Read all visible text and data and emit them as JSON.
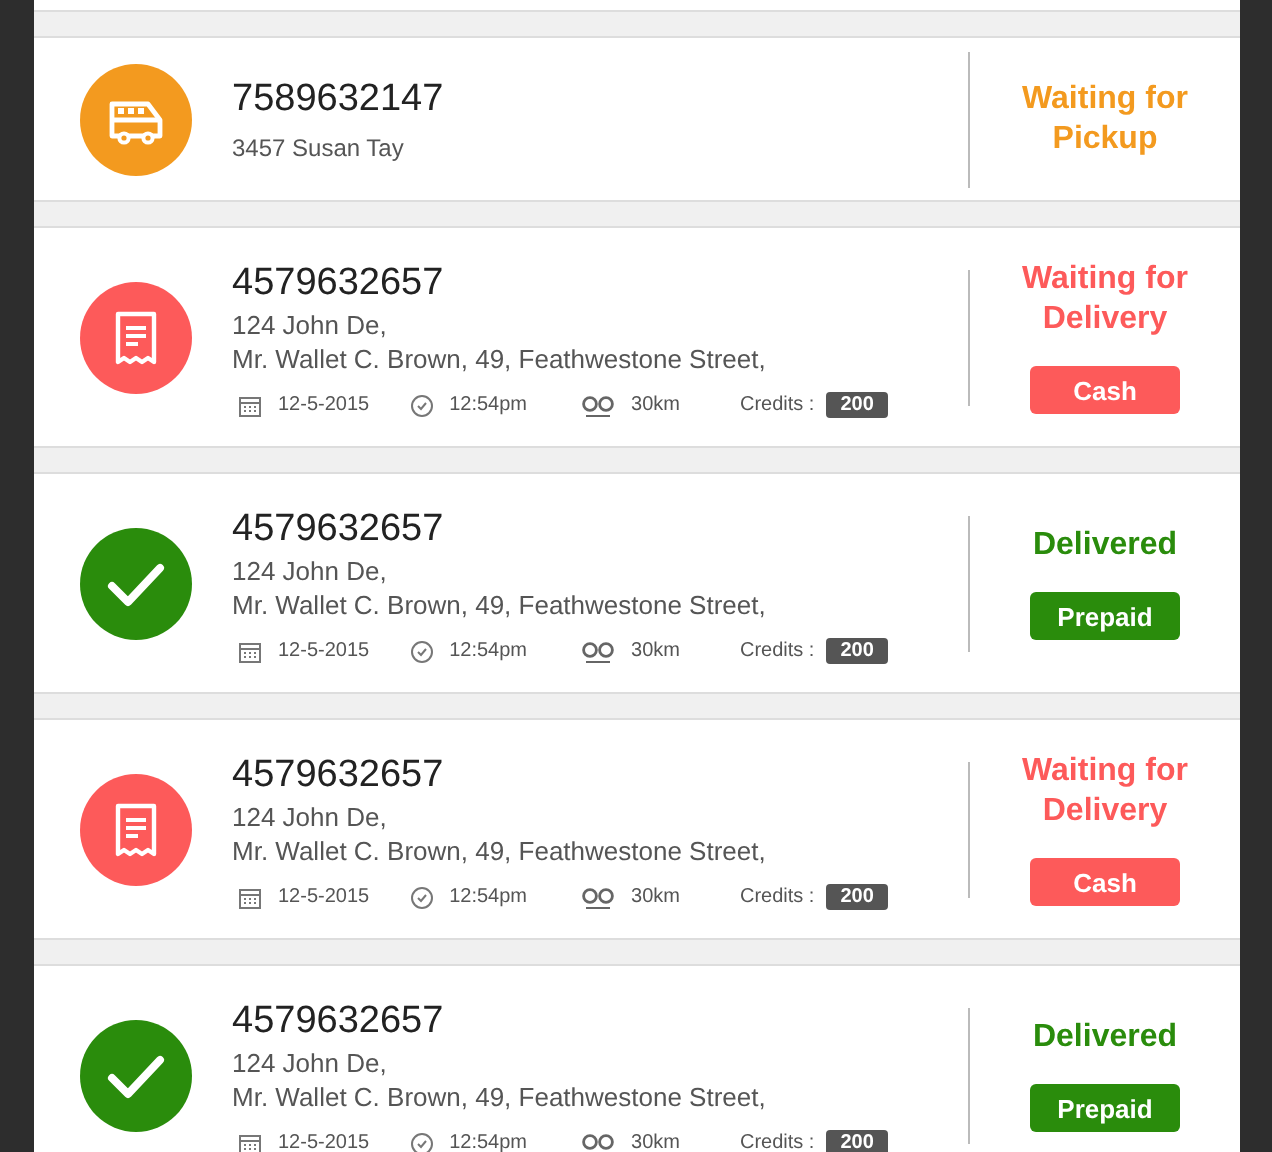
{
  "orders": [
    {
      "kind": "pickup",
      "phone": "7589632147",
      "address_lines": [
        "3457 Susan Tay"
      ],
      "status": "Waiting for Pickup"
    },
    {
      "kind": "delivery",
      "phone": "4579632657",
      "address_lines": [
        "124 John De,",
        "Mr. Wallet C. Brown, 49, Feathwestone Street,"
      ],
      "date": "12-5-2015",
      "time": "12:54pm",
      "distance": "30km",
      "credits_label": "Credits :",
      "credits": "200",
      "status": "Waiting for Delivery",
      "payment": "Cash"
    },
    {
      "kind": "delivered",
      "phone": "4579632657",
      "address_lines": [
        "124 John De,",
        "Mr. Wallet C. Brown, 49, Feathwestone Street,"
      ],
      "date": "12-5-2015",
      "time": "12:54pm",
      "distance": "30km",
      "credits_label": "Credits :",
      "credits": "200",
      "status": "Delivered",
      "payment": "Prepaid"
    },
    {
      "kind": "delivery",
      "phone": "4579632657",
      "address_lines": [
        "124 John De,",
        "Mr. Wallet C. Brown, 49, Feathwestone Street,"
      ],
      "date": "12-5-2015",
      "time": "12:54pm",
      "distance": "30km",
      "credits_label": "Credits :",
      "credits": "200",
      "status": "Waiting for Delivery",
      "payment": "Cash"
    },
    {
      "kind": "delivered",
      "phone": "4579632657",
      "address_lines": [
        "124 John De,",
        "Mr. Wallet C. Brown, 49, Feathwestone Street,"
      ],
      "date": "12-5-2015",
      "time": "12:54pm",
      "distance": "30km",
      "credits_label": "Credits :",
      "credits": "200",
      "status": "Delivered",
      "payment": "Prepaid"
    }
  ]
}
